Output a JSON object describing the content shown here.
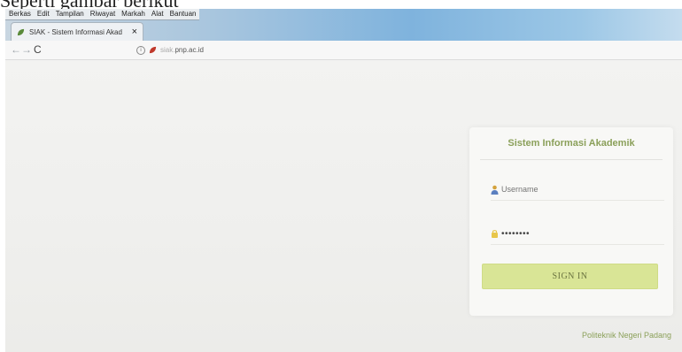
{
  "caption": "Seperti gambar berikut",
  "browser": {
    "menu": [
      "Berkas",
      "Edit",
      "Tampilan",
      "Riwayat",
      "Markah",
      "Alat",
      "Bantuan"
    ],
    "tab": {
      "title": "SIAK - Sistem Informasi Akad",
      "close": "×"
    },
    "nav": {
      "back": "←",
      "forward": "→",
      "reload": "C"
    },
    "url": {
      "prefix": "siak.",
      "domain": "pnp.ac.id"
    }
  },
  "login": {
    "title": "Sistem Informasi Akademik",
    "username_placeholder": "Username",
    "password_value": "••••••••",
    "signin_label": "SIGN IN"
  },
  "footer": "Politeknik Negeri Padang",
  "colors": {
    "accent_text": "#8ba05a",
    "button_bg": "#d9e596",
    "titlebar": "#7fb3dd"
  }
}
